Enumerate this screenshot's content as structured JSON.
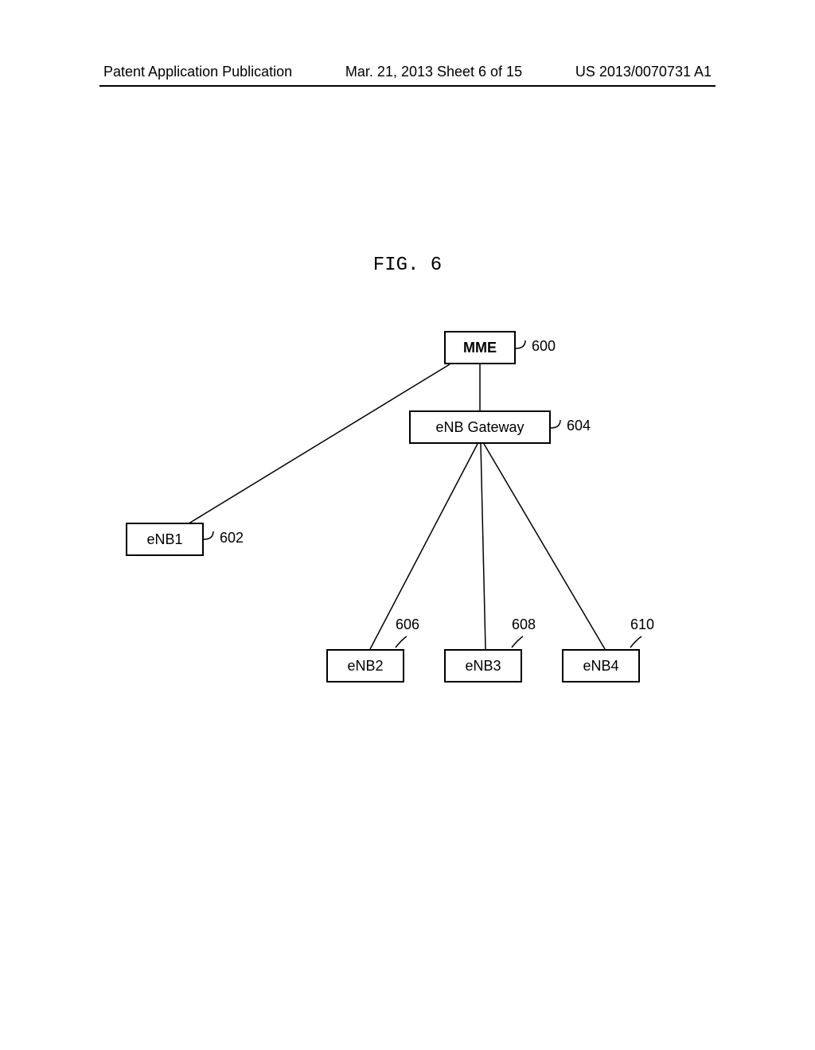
{
  "header": {
    "left": "Patent Application Publication",
    "center": "Mar. 21, 2013  Sheet 6 of 15",
    "right": "US 2013/0070731 A1"
  },
  "figure": {
    "title": "FIG. 6"
  },
  "nodes": {
    "mme": {
      "label": "MME",
      "ref": "600"
    },
    "enb1": {
      "label": "eNB1",
      "ref": "602"
    },
    "gateway": {
      "label": "eNB Gateway",
      "ref": "604"
    },
    "enb2": {
      "label": "eNB2",
      "ref": "606"
    },
    "enb3": {
      "label": "eNB3",
      "ref": "608"
    },
    "enb4": {
      "label": "eNB4",
      "ref": "610"
    }
  }
}
